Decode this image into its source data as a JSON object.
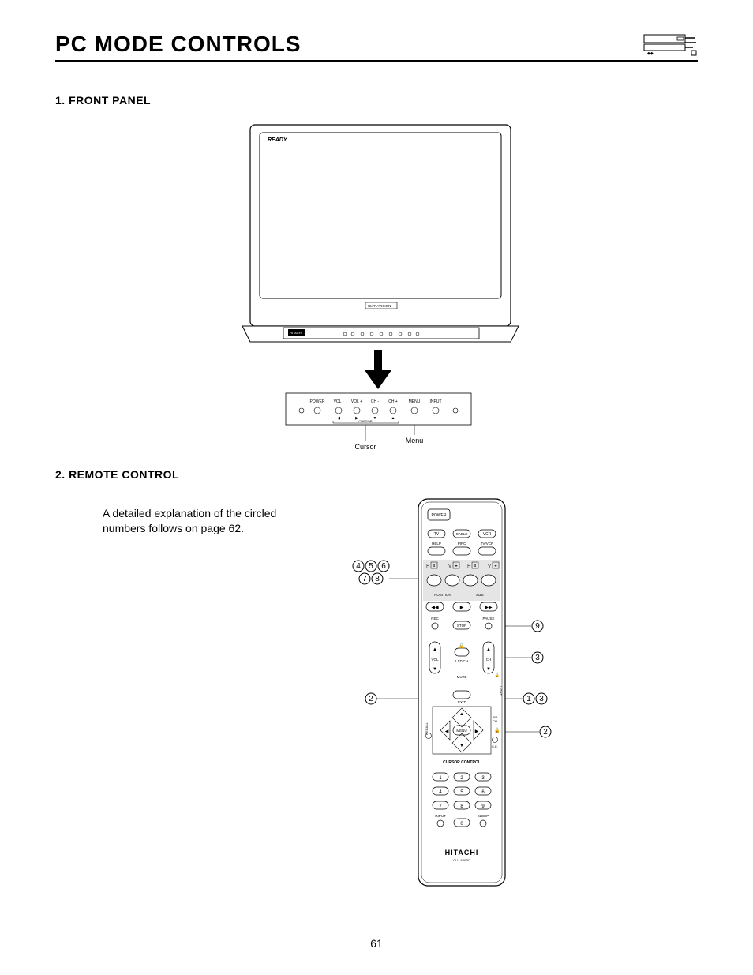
{
  "header": {
    "title": "PC MODE CONTROLS"
  },
  "sections": {
    "front_panel_heading": "1. FRONT PANEL",
    "remote_heading": "2. REMOTE CONTROL"
  },
  "front_panel": {
    "ready_label": "READY",
    "brand_small": "ULTRAVISION",
    "logo_small": "HITACHI",
    "buttons": {
      "power": "POWER",
      "vol_minus": "VOL -",
      "vol_plus": "VOL +",
      "ch_minus": "CH -",
      "ch_plus": "CH +",
      "menu": "MENU",
      "input": "INPUT",
      "cursor_bracket": "CURSOR"
    },
    "callout_cursor": "Cursor",
    "callout_menu": "Menu"
  },
  "remote_text": {
    "line": "A detailed explanation of the circled numbers follows on page 62."
  },
  "callouts": {
    "group_top": [
      "4",
      "5",
      "6"
    ],
    "group_second": [
      "7",
      "8"
    ],
    "left_mid": "2",
    "right_pause": "9",
    "right_ch": "3",
    "right_pair": [
      "1",
      "3"
    ],
    "right_lower": "2"
  },
  "remote": {
    "power": "POWER",
    "tv": "TV",
    "cable": "CABLE",
    "vcr": "VCR",
    "help": "HELP",
    "pipc": "PIPC",
    "tvvcr": "TV/VCR",
    "h1": "H",
    "v1": "V",
    "h2": "H",
    "v2": "V",
    "position": "POSITION",
    "size": "SIZE",
    "rec": "REC",
    "stop": "STOP",
    "pause": "PAUSE",
    "vol": "VOL",
    "lstch": "LST-CH",
    "ch": "CH",
    "mute": "MUTE",
    "exit": "EXIT",
    "light": "LIGHT",
    "recall": "RECALL",
    "menu": "MENU",
    "pip_ch": "PIP CH",
    "ce": "C.E.",
    "cursor_control": "CURSOR CONTROL",
    "keypad": [
      "1",
      "2",
      "3",
      "4",
      "5",
      "6",
      "7",
      "8",
      "9",
      "0"
    ],
    "input": "INPUT",
    "sleep": "SLEEP",
    "brand": "HITACHI",
    "model": "CLU-620PC"
  },
  "page_number": "61"
}
